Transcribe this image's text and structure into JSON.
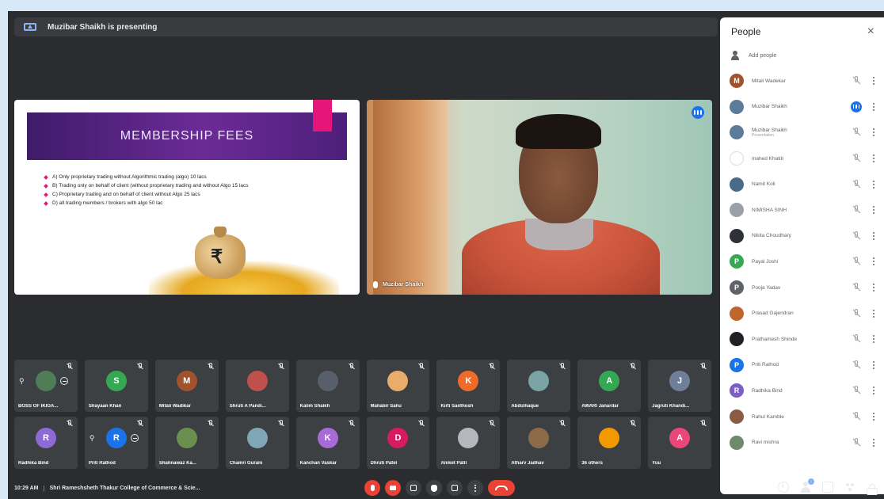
{
  "banner": {
    "text": "Muzibar Shaikh is presenting"
  },
  "slide": {
    "title": "MEMBERSHIP FEES",
    "bullets": [
      "A) Only proprietary trading without Algorithmic trading (algo) 10 lacs",
      "B) Trading only on behalf of client (without proprietary trading and without Algo 15 lacs",
      "C) Proprietary trading and on behalf of client without Algo 25 lacs",
      "D) all trading members / brokers with algo 50 lac"
    ],
    "bag_symbol": "₹"
  },
  "video": {
    "name": "Muzibar Shaikh"
  },
  "people_panel": {
    "title": "People",
    "close": "×",
    "add_people": "Add people",
    "participants": [
      {
        "initial": "M",
        "name": "Mitali Wadekar",
        "sub": "",
        "color": "#a0522d",
        "state": "muted"
      },
      {
        "initial": "",
        "name": "Muzibar Shaikh",
        "sub": "",
        "color": "#5b7c99",
        "state": "speaking"
      },
      {
        "initial": "",
        "name": "Muzibar Shaikh",
        "sub": "Presentation",
        "color": "#5b7c99",
        "state": "muted"
      },
      {
        "initial": "",
        "name": "mahed Khatib",
        "sub": "",
        "color": "#ffffff",
        "state": "muted"
      },
      {
        "initial": "",
        "name": "Namit Koli",
        "sub": "",
        "color": "#4a6b88",
        "state": "muted"
      },
      {
        "initial": "",
        "name": "NIMISHA SINH",
        "sub": "",
        "color": "#9aa0a6",
        "state": "muted"
      },
      {
        "initial": "",
        "name": "Nikita Choudhary",
        "sub": "",
        "color": "#2e3136",
        "state": "muted"
      },
      {
        "initial": "P",
        "name": "Payal Joshi",
        "sub": "",
        "color": "#34a853",
        "state": "muted"
      },
      {
        "initial": "P",
        "name": "Pooja Yadav",
        "sub": "",
        "color": "#5f6368",
        "state": "muted"
      },
      {
        "initial": "",
        "name": "Prasad Gajendran",
        "sub": "",
        "color": "#c0652c",
        "state": "muted"
      },
      {
        "initial": "",
        "name": "Prathamesh Shinde",
        "sub": "",
        "color": "#202124",
        "state": "muted"
      },
      {
        "initial": "P",
        "name": "Priti Rathod",
        "sub": "",
        "color": "#1a73e8",
        "state": "muted"
      },
      {
        "initial": "R",
        "name": "Radhika Bind",
        "sub": "",
        "color": "#7b5fc6",
        "state": "muted"
      },
      {
        "initial": "",
        "name": "Rahul Kamble",
        "sub": "",
        "color": "#8a5a44",
        "state": "muted"
      },
      {
        "initial": "",
        "name": "Ravi mishra",
        "sub": "",
        "color": "#6d8a6a",
        "state": "muted"
      }
    ]
  },
  "tiles_row1": [
    {
      "label": "BOSS OF IKIGA...",
      "initial": "",
      "color": "#4e7d56",
      "pin": true
    },
    {
      "label": "Shayaan Khan",
      "initial": "S",
      "color": "#34a853",
      "pin": false
    },
    {
      "label": "Mitali Wadikar",
      "initial": "M",
      "color": "#a0522d",
      "pin": false
    },
    {
      "label": "Shruti A Pandi...",
      "initial": "",
      "color": "#c0504d",
      "pin": false
    },
    {
      "label": "Kalim Shaikh",
      "initial": "",
      "color": "#57606a",
      "pin": false
    },
    {
      "label": "Mahabir Sahu",
      "initial": "",
      "color": "#e8ad6a",
      "pin": false
    },
    {
      "label": "Kirti Santhosh",
      "initial": "K",
      "color": "#f06a2a",
      "pin": false
    },
    {
      "label": "Abdulhaque",
      "initial": "",
      "color": "#7aa4a6",
      "pin": false
    },
    {
      "label": "AWARI Janardar",
      "initial": "A",
      "color": "#34a853",
      "pin": false
    },
    {
      "label": "Jagruti Khandi...",
      "initial": "J",
      "color": "#6f7f9a",
      "pin": false
    }
  ],
  "tiles_row2": [
    {
      "label": "Radhika Bind",
      "initial": "R",
      "color": "#8e6ad6",
      "pin": false
    },
    {
      "label": "Priti Rathod",
      "initial": "R",
      "color": "#1a73e8",
      "pin": true
    },
    {
      "label": "Shahnawaz Ka...",
      "initial": "",
      "color": "#6a8f4f",
      "pin": false
    },
    {
      "label": "Chamri Gurani",
      "initial": "",
      "color": "#7ea6b4",
      "pin": false
    },
    {
      "label": "Kanchan Vaskar",
      "initial": "K",
      "color": "#a66bd6",
      "pin": false
    },
    {
      "label": "Dhruti Patel",
      "initial": "D",
      "color": "#d81b60",
      "pin": false
    },
    {
      "label": "Aniket Patil",
      "initial": "",
      "color": "#b4b8bd",
      "pin": false
    },
    {
      "label": "Atharv Jadhav",
      "initial": "",
      "color": "#8c6b4a",
      "pin": false
    },
    {
      "label": "36 others",
      "initial": "",
      "color": "#f29900",
      "pin": false
    },
    {
      "label": "Yuu",
      "initial": "A",
      "color": "#e94779",
      "pin": false
    }
  ],
  "bottom": {
    "time": "10:29 AM",
    "separator": "|",
    "meeting": "Shri Rameshsheth Thakur College of Commerce & Scie..."
  },
  "colors": {
    "accent": "#1a73e8",
    "danger": "#ea4335",
    "background": "#2b2c30"
  }
}
